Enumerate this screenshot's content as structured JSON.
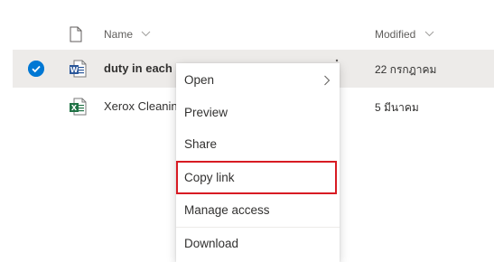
{
  "list_header": {
    "name_label": "Name",
    "modified_label": "Modified"
  },
  "rows": [
    {
      "name": "duty in each",
      "modified": "22 กรกฎาคม",
      "type": "word",
      "selected": true
    },
    {
      "name": "Xerox Cleanin",
      "modified": "5 มีนาคม",
      "type": "excel",
      "selected": false
    }
  ],
  "context_menu": {
    "items": [
      {
        "label": "Open",
        "has_submenu": true
      },
      {
        "label": "Preview"
      },
      {
        "label": "Share"
      },
      {
        "label": "Copy link",
        "highlighted": true
      },
      {
        "label": "Manage access"
      },
      {
        "label": "Download"
      }
    ]
  },
  "colors": {
    "accent": "#0078d4",
    "selected_row": "#edebe9",
    "highlight_border": "#d81b23",
    "word_blue": "#2b579a",
    "excel_green": "#217346"
  },
  "icons": {
    "header_file": "file-icon",
    "checkmark": "checkmark-icon",
    "word": "word-file-icon",
    "excel": "excel-file-icon",
    "more": "more-actions-icon",
    "submenu": "chevron-right-icon"
  }
}
